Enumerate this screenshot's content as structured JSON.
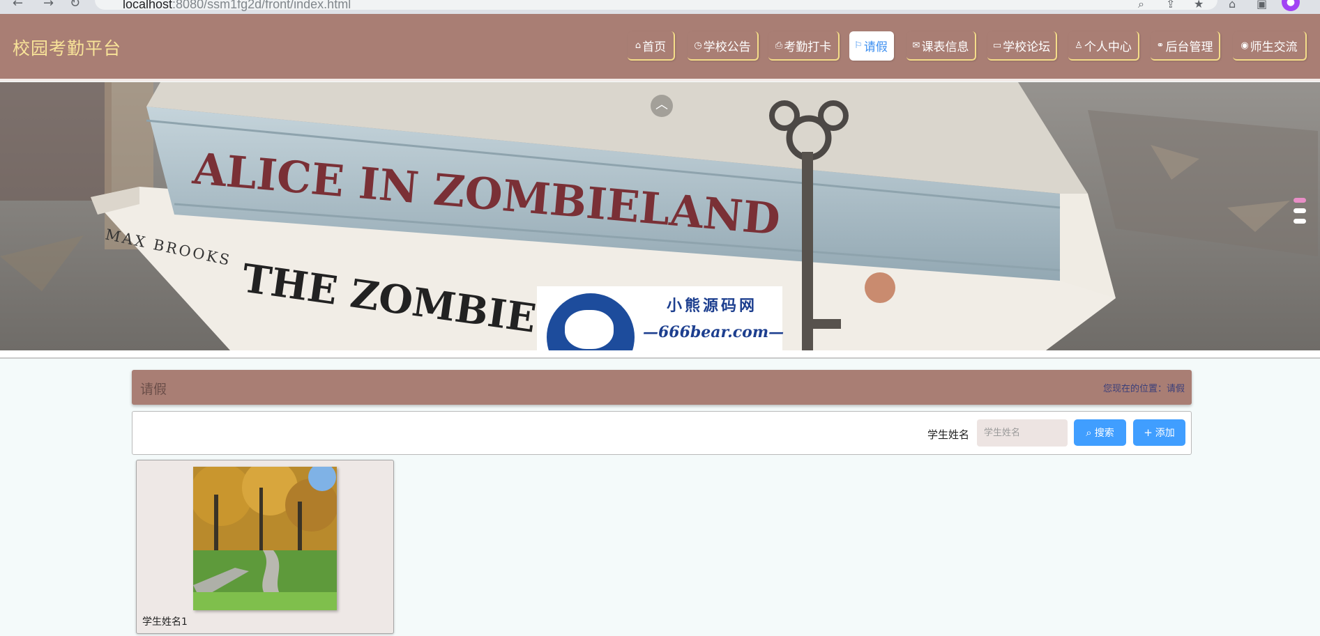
{
  "browser": {
    "url_host": "localhost",
    "url_rest": ":8080/ssm1fg2d/front/index.html"
  },
  "header": {
    "site_title": "校园考勤平台",
    "nav": [
      {
        "label": "首页",
        "icon": "home-icon",
        "glyph": "⌂",
        "active": false
      },
      {
        "label": "学校公告",
        "icon": "clock-icon",
        "glyph": "◷",
        "active": false
      },
      {
        "label": "考勤打卡",
        "icon": "print-icon",
        "glyph": "⎙",
        "active": false
      },
      {
        "label": "请假",
        "icon": "flag-icon",
        "glyph": "⚐",
        "active": true
      },
      {
        "label": "课表信息",
        "icon": "mail-icon",
        "glyph": "✉",
        "active": false
      },
      {
        "label": "学校论坛",
        "icon": "book-icon",
        "glyph": "▭",
        "active": false
      },
      {
        "label": "个人中心",
        "icon": "user-icon",
        "glyph": "♙",
        "active": false
      },
      {
        "label": "后台管理",
        "icon": "link-icon",
        "glyph": "⚭",
        "active": false
      },
      {
        "label": "师生交流",
        "icon": "chat-icon",
        "glyph": "◉",
        "active": false
      }
    ]
  },
  "banner": {
    "book_top": "ALICE IN ZOMBIELAND",
    "book_author": "MAX BROOKS",
    "book_bottom": "THE ZOMBIE SURV",
    "promo_line1": "小熊源码网",
    "promo_line2": "—666bear.com—",
    "carousel_count": 3,
    "carousel_active": 0
  },
  "section": {
    "title": "请假",
    "breadcrumb": "您现在的位置：请假"
  },
  "search": {
    "label": "学生姓名",
    "placeholder": "学生姓名",
    "search_button": "搜索",
    "add_button": "添加"
  },
  "cards": [
    {
      "name": "学生姓名1"
    }
  ],
  "colors": {
    "header_bg": "#a97e74",
    "title_color": "#f8e398",
    "accent": "#409eff",
    "page_bg": "#f4fafa"
  }
}
